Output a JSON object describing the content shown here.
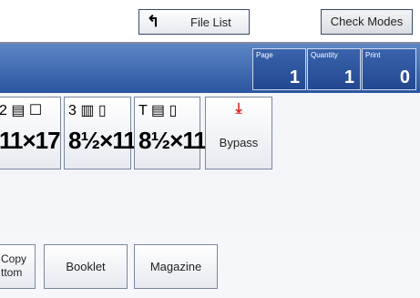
{
  "toolbar": {
    "file_list_icon": "return-arrow-icon",
    "file_list_label": "File List",
    "check_modes_label": "Check Modes"
  },
  "counters": [
    {
      "label": "Page",
      "value": "1"
    },
    {
      "label": "Quantity",
      "value": "1"
    },
    {
      "label": "Print",
      "value": "0"
    }
  ],
  "trays": [
    {
      "icons": "2 ▤ ☐",
      "size": "11×17"
    },
    {
      "icons": "3 ▥ ▯",
      "size": "8½×11"
    },
    {
      "icons": "T ▤ ▯",
      "size": "8½×11"
    }
  ],
  "bypass": {
    "icon": "bypass-tray-icon",
    "label": "Bypass"
  },
  "functions": {
    "copy_bottom_line1": "Copy",
    "copy_bottom_line2": "ttom",
    "booklet": "Booklet",
    "magazine": "Magazine"
  },
  "colors": {
    "accent_blue": "#2b56a0",
    "bypass_red": "#d62020"
  }
}
